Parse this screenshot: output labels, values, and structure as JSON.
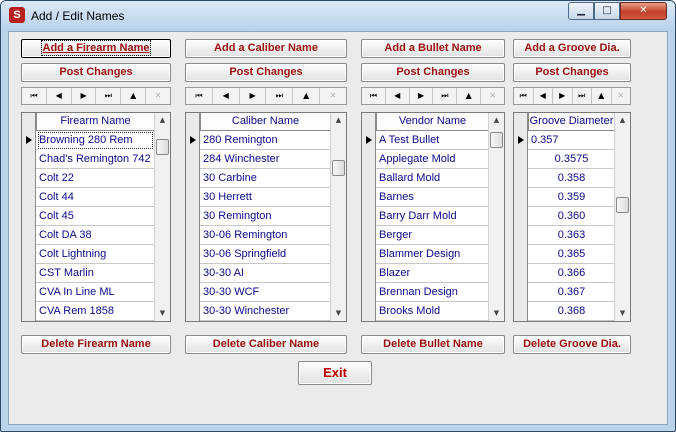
{
  "window": {
    "title": "Add / Edit Names",
    "app_icon": "S",
    "min_glyph": "▁",
    "max_glyph": "□",
    "close_glyph": "✕"
  },
  "nav_glyphs": [
    "⏮",
    "◀",
    "▶",
    "⏭",
    "▲",
    "✕"
  ],
  "columns": {
    "firearm": {
      "add_label": "Add a Firearm Name",
      "post_label": "Post Changes",
      "header": "Firearm Name",
      "delete_label": "Delete Firearm Name",
      "rows": [
        "Browning 280 Rem",
        "Chad's Remington 742",
        "Colt 22",
        "Colt 44",
        "Colt 45",
        "Colt DA 38",
        "Colt Lightning",
        "CST Marlin",
        "CVA In Line ML",
        "CVA Rem 1858"
      ]
    },
    "caliber": {
      "add_label": "Add a Caliber Name",
      "post_label": "Post Changes",
      "header": "Caliber Name",
      "delete_label": "Delete Caliber Name",
      "rows": [
        "280 Remington",
        "284 Winchester",
        "30 Carbine",
        "30 Herrett",
        "30 Remington",
        "30-06 Remington",
        "30-06 Springfield",
        "30-30 AI",
        "30-30 WCF",
        "30-30 Winchester"
      ]
    },
    "bullet": {
      "add_label": "Add a Bullet Name",
      "post_label": "Post Changes",
      "header": "Vendor Name",
      "delete_label": "Delete Bullet Name",
      "rows": [
        "A Test Bullet",
        "Applegate Mold",
        "Ballard Mold",
        "Barnes",
        "Barry Darr Mold",
        "Berger",
        "Blammer Design",
        "Blazer",
        "Brennan Design",
        "Brooks Mold"
      ]
    },
    "groove": {
      "add_label": "Add a Groove Dia.",
      "post_label": "Post Changes",
      "header": "Groove Diameter",
      "delete_label": "Delete Groove Dia.",
      "rows": [
        "0.357",
        "0.3575",
        "0.358",
        "0.359",
        "0.360",
        "0.363",
        "0.365",
        "0.366",
        "0.367",
        "0.368"
      ]
    }
  },
  "exit_label": "Exit",
  "colors": {
    "button_text": "#9b0f0f",
    "cell_text": "#0a0a8a",
    "client_bg": "#ebebeb"
  }
}
